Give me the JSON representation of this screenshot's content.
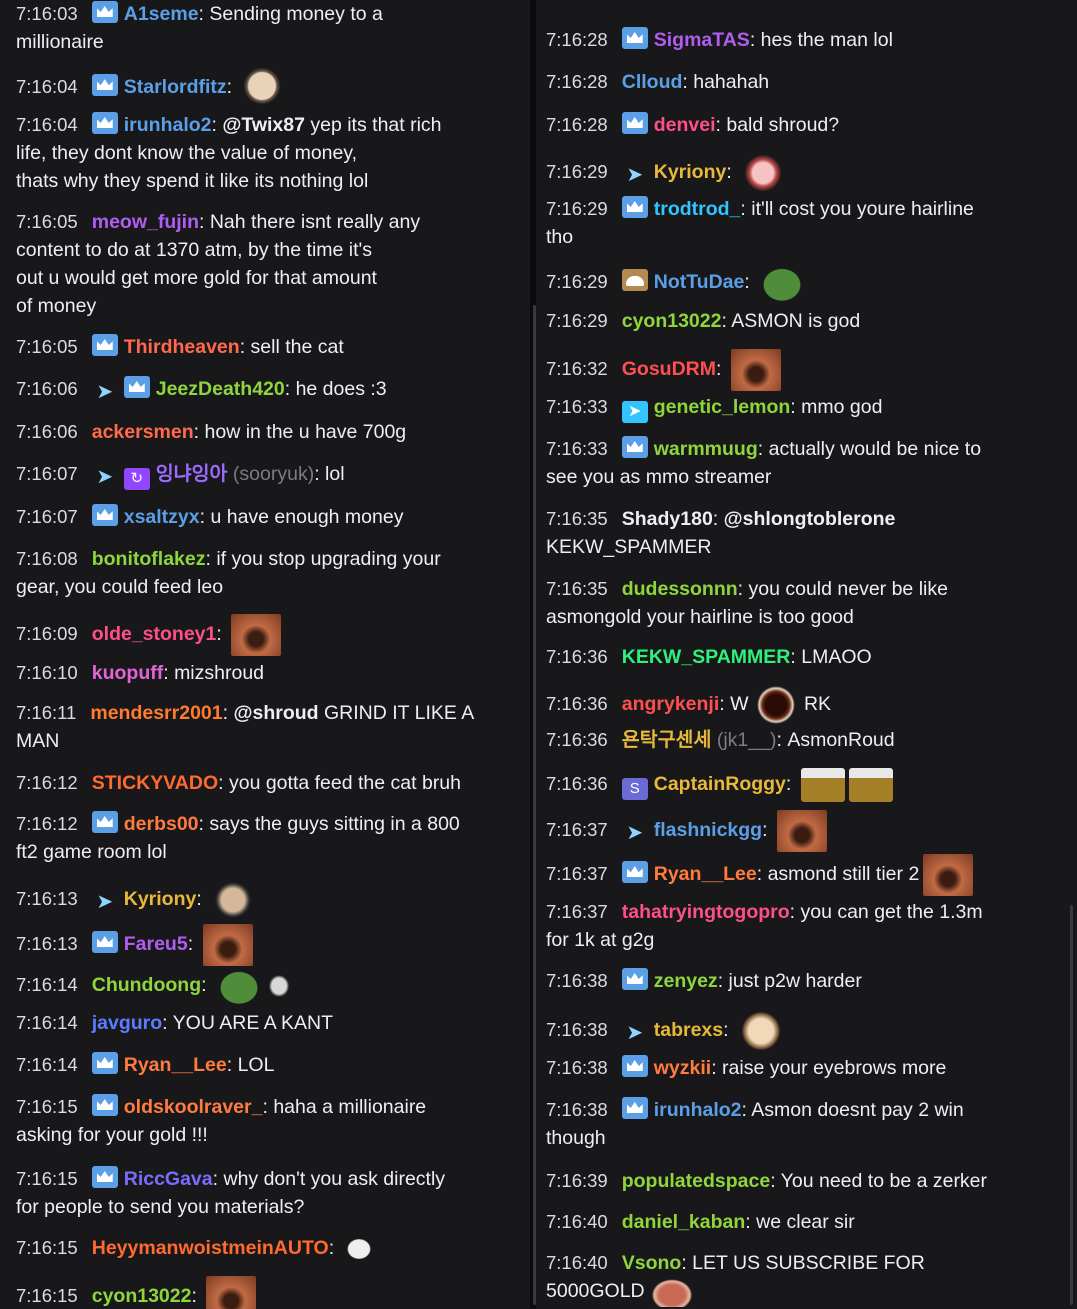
{
  "left": [
    {
      "ts": "7:16:03",
      "user": "A1seme",
      "color": "#5b9fe6",
      "badges": [
        "crown"
      ],
      "msg": "Sending money to a",
      "cont": "millionaire"
    },
    {
      "ts": "7:16:04",
      "user": "Starlordfitz",
      "color": "#5b9fe6",
      "badges": [
        "crown"
      ],
      "emotes": [
        "bald"
      ]
    },
    {
      "ts": "7:16:04",
      "user": "irunhalo2",
      "color": "#5b9fe6",
      "badges": [
        "crown"
      ],
      "mention": "@Twix87",
      "msg": " yep its that rich",
      "cont": "life, they dont know the value of money,",
      "cont2": "thats why they spend it like its nothing lol"
    },
    {
      "ts": "7:16:05",
      "user": "meow_fujin",
      "color": "#b15df0",
      "badges": [],
      "msg": "Nah there isnt really any",
      "cont": "content to do at 1370 atm, by the time it's",
      "cont2": "out u would get more gold for that amount",
      "cont3": "of money"
    },
    {
      "ts": "7:16:05",
      "user": "Thirdheaven",
      "color": "#ff6a4d",
      "badges": [
        "crown"
      ],
      "msg": "sell the cat"
    },
    {
      "ts": "7:16:06",
      "user": "JeezDeath420",
      "color": "#8ed63c",
      "badges": [
        "prime",
        "crown"
      ],
      "msg": "he does :3"
    },
    {
      "ts": "7:16:06",
      "user": "ackersmen",
      "color": "#ff6a4d",
      "badges": [],
      "msg": "how in the        u have 700g"
    },
    {
      "ts": "7:16:07",
      "user": "잉냐잉아",
      "alt": "(sooryuk)",
      "color": "#9c6bff",
      "badges": [
        "prime",
        "purple"
      ],
      "msg": "lol"
    },
    {
      "ts": "7:16:07",
      "user": "xsaltzyx",
      "color": "#5b9fe6",
      "badges": [
        "crown"
      ],
      "msg": "u have enough money"
    },
    {
      "ts": "7:16:08",
      "user": "bonitoflakez",
      "color": "#8ed63c",
      "badges": [],
      "msg": "if you stop upgrading your",
      "cont": "gear, you could feed leo"
    },
    {
      "ts": "7:16:09",
      "user": "olde_stoney1",
      "color": "#ff4f8a",
      "badges": [],
      "emotes": [
        "face"
      ]
    },
    {
      "ts": "7:16:10",
      "user": "kuopuff",
      "color": "#e066d6",
      "badges": [],
      "msg": "mizshroud"
    },
    {
      "ts": "7:16:11",
      "user": "mendesrr2001",
      "color": "#ff7b2e",
      "badges": [],
      "mention": "@shroud",
      "msg": " GRIND IT LIKE A",
      "cont": "MAN"
    },
    {
      "ts": "7:16:12",
      "user": "STICKYVADO",
      "color": "#ff6a2e",
      "badges": [],
      "msg": "you gotta feed the cat bruh"
    },
    {
      "ts": "7:16:12",
      "user": "derbs00",
      "color": "#ff7b3e",
      "badges": [
        "crown"
      ],
      "msg": "says the guys sitting in a 800",
      "cont": "ft2 game room lol"
    },
    {
      "ts": "7:16:13",
      "user": "Kyriony",
      "color": "#e8b83a",
      "badges": [
        "prime"
      ],
      "emotes": [
        "man"
      ]
    },
    {
      "ts": "7:16:13",
      "user": "Fareu5",
      "color": "#b15df0",
      "badges": [
        "crown"
      ],
      "emotes": [
        "face"
      ]
    },
    {
      "ts": "7:16:14",
      "user": "Chundoong",
      "color": "#8ed63c",
      "badges": [],
      "emotes": [
        "pepe",
        "feather"
      ]
    },
    {
      "ts": "7:16:14",
      "user": "javguro",
      "color": "#5b7cff",
      "badges": [],
      "msg": "YOU ARE A         KANT"
    },
    {
      "ts": "7:16:14",
      "user": "Ryan__Lee",
      "color": "#ff7b3e",
      "badges": [
        "crown"
      ],
      "msg": "LOL"
    },
    {
      "ts": "7:16:15",
      "user": "oldskoolraver_",
      "color": "#ff7b3e",
      "badges": [
        "crown"
      ],
      "msg": "haha a millionaire",
      "cont": "asking for your gold !!!"
    },
    {
      "ts": "7:16:15",
      "user": "RiccGava",
      "color": "#7c6bff",
      "badges": [
        "crown"
      ],
      "msg": "why don't you ask directly",
      "cont": "for people to send you materials?"
    },
    {
      "ts": "7:16:15",
      "user": "HeyymanwoistmeinAUTO",
      "color": "#ff6a2e",
      "badges": [],
      "emotes": [
        "ghost"
      ]
    },
    {
      "ts": "7:16:15",
      "user": "cyon13022",
      "color": "#8ed63c",
      "badges": [],
      "emotes": [
        "face"
      ]
    }
  ],
  "right": [
    {
      "ts": "7:16:28",
      "user": "SigmaTAS",
      "color": "#b15df0",
      "badges": [
        "crown"
      ],
      "msg": "hes the man lol"
    },
    {
      "ts": "7:16:28",
      "user": "Clloud",
      "color": "#5b9fe6",
      "badges": [],
      "msg": "hahahah"
    },
    {
      "ts": "7:16:28",
      "user": "denvei",
      "color": "#ff4f8a",
      "badges": [
        "crown"
      ],
      "msg": "bald shroud?"
    },
    {
      "ts": "7:16:29",
      "user": "Kyriony",
      "color": "#e8b83a",
      "badges": [
        "prime"
      ],
      "emotes": [
        "anime"
      ]
    },
    {
      "ts": "7:16:29",
      "user": "trodtrod_",
      "color": "#33c3ff",
      "badges": [
        "crown"
      ],
      "msg": "it'll cost you youre hairline",
      "cont": "tho"
    },
    {
      "ts": "7:16:29",
      "user": "NotTuDae",
      "color": "#5b9fe6",
      "badges": [
        "hat"
      ],
      "emotes": [
        "pepe"
      ]
    },
    {
      "ts": "7:16:29",
      "user": "cyon13022",
      "color": "#8ed63c",
      "badges": [],
      "msg": "ASMON is god"
    },
    {
      "ts": "7:16:32",
      "user": "GosuDRM",
      "color": "#ff4f4f",
      "badges": [],
      "emotes": [
        "face"
      ]
    },
    {
      "ts": "7:16:33",
      "user": "genetic_lemon",
      "color": "#8ed63c",
      "badges": [
        "prime2"
      ],
      "msg": "mmo god"
    },
    {
      "ts": "7:16:33",
      "user": "warmmuug",
      "color": "#8ed63c",
      "badges": [
        "crown"
      ],
      "msg": "actually would be nice to",
      "cont": "see you as mmo streamer"
    },
    {
      "ts": "7:16:35",
      "user": "Shady180",
      "color": "#efeff1",
      "badges": [],
      "mention": "@shlongtoblerone",
      "msg": "",
      "cont": "KEKW_SPAMMER"
    },
    {
      "ts": "7:16:35",
      "user": "dudessonnn",
      "color": "#8ed63c",
      "badges": [],
      "msg": "you could never be like",
      "cont": "asmongold your hairline is too good"
    },
    {
      "ts": "7:16:36",
      "user": "KEKW_SPAMMER",
      "color": "#2ef07a",
      "badges": [],
      "msg": "LMAOO"
    },
    {
      "ts": "7:16:36",
      "user": "angrykenji",
      "color": "#ff4f4f",
      "badges": [],
      "msg": "W",
      "emotes": [
        "hole"
      ],
      "after": "RK"
    },
    {
      "ts": "7:16:36",
      "user": "욘탁구센세",
      "alt": "(jk1__)",
      "color": "#e8b83a",
      "badges": [],
      "msg": "AsmonRoud"
    },
    {
      "ts": "7:16:36",
      "user": "CaptainRoggy",
      "color": "#e8b83a",
      "badges": [
        "gem"
      ],
      "emotes": [
        "gold",
        "gold"
      ]
    },
    {
      "ts": "7:16:37",
      "user": "flashnickgg",
      "color": "#5b9fe6",
      "badges": [
        "prime"
      ],
      "emotes": [
        "face"
      ]
    },
    {
      "ts": "7:16:37",
      "user": "Ryan__Lee",
      "color": "#ff7b3e",
      "badges": [
        "crown"
      ],
      "msg": "asmond still tier 2",
      "emotes": [
        "face"
      ]
    },
    {
      "ts": "7:16:37",
      "user": "tahatryingtogopro",
      "color": "#ff4f8a",
      "badges": [],
      "msg": "you can get the 1.3m",
      "cont": "for 1k at g2g"
    },
    {
      "ts": "7:16:38",
      "user": "zenyez",
      "color": "#8ed63c",
      "badges": [
        "crown"
      ],
      "msg": "just p2w harder"
    },
    {
      "ts": "7:16:38",
      "user": "tabrexs",
      "color": "#e8b83a",
      "badges": [
        "prime"
      ],
      "emotes": [
        "laugh"
      ]
    },
    {
      "ts": "7:16:38",
      "user": "wyzkii",
      "color": "#ff7b3e",
      "badges": [
        "crown"
      ],
      "msg": "raise your eyebrows more"
    },
    {
      "ts": "7:16:38",
      "user": "irunhalo2",
      "color": "#5b9fe6",
      "badges": [
        "crown"
      ],
      "msg": "Asmon doesnt pay 2 win",
      "cont": "though"
    },
    {
      "ts": "7:16:39",
      "user": "populatedspace",
      "color": "#8ed63c",
      "badges": [],
      "msg": "You need to be a zerker"
    },
    {
      "ts": "7:16:40",
      "user": "daniel_kaban",
      "color": "#8ed63c",
      "badges": [],
      "msg": "we clear sir"
    },
    {
      "ts": "7:16:40",
      "user": "Vsono",
      "color": "#8ed63c",
      "badges": [],
      "msg": "LET US SUBSCRIBE FOR",
      "cont": "5000GOLD",
      "emotes_cont": [
        "lips"
      ]
    }
  ]
}
